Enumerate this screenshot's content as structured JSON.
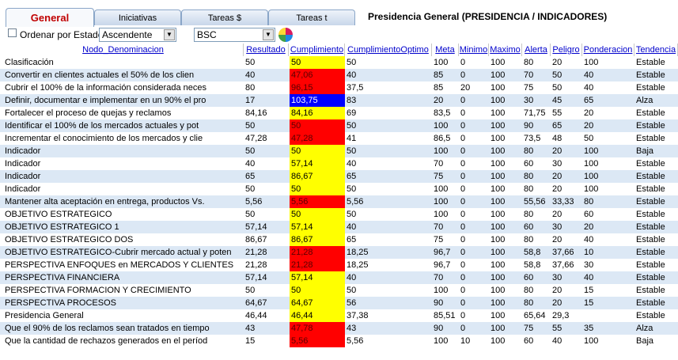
{
  "tabs": [
    {
      "label": "General"
    },
    {
      "label": "Iniciativas"
    },
    {
      "label": "Tareas $"
    },
    {
      "label": "Tareas t"
    }
  ],
  "page_title": "Presidencia General (PRESIDENCIA / INDICADORES)",
  "toolbar": {
    "order_label": "Ordenar por Estado",
    "sort_value": "Ascendente",
    "view_value": "BSC"
  },
  "colors": {
    "yellow": "#ffff00",
    "red": "#ff0000",
    "blue": "#0000ff",
    "row_alt": "#dce8f5"
  },
  "table": {
    "columns": [
      "Nodo_Denominacion",
      "Resultado",
      "Cumplimiento",
      "CumplimientoOptimo",
      "Meta",
      "Minimo",
      "Maximo",
      "Alerta",
      "Peligro",
      "Ponderacion",
      "Tendencia"
    ],
    "rows": [
      {
        "nodo": "Clasificación",
        "resultado": "50",
        "cumplimiento": "50",
        "status": "yellow",
        "optimo": "50",
        "meta": "100",
        "minimo": "0",
        "maximo": "100",
        "alerta": "80",
        "peligro": "20",
        "ponderacion": "100",
        "tendencia": "Estable"
      },
      {
        "nodo": "Convertir en clientes actuales el 50% de los clien",
        "resultado": "40",
        "cumplimiento": "47,06",
        "status": "red",
        "optimo": "40",
        "meta": "85",
        "minimo": "0",
        "maximo": "100",
        "alerta": "70",
        "peligro": "50",
        "ponderacion": "40",
        "tendencia": "Estable"
      },
      {
        "nodo": "Cubrir el 100% de la información considerada neces",
        "resultado": "80",
        "cumplimiento": "96,15",
        "status": "red",
        "optimo": "37,5",
        "meta": "85",
        "minimo": "20",
        "maximo": "100",
        "alerta": "75",
        "peligro": "50",
        "ponderacion": "40",
        "tendencia": "Estable"
      },
      {
        "nodo": "Definir, documentar e implementar en un 90% el pro",
        "resultado": "17",
        "cumplimiento": "103,75",
        "status": "blue",
        "optimo": "83",
        "meta": "20",
        "minimo": "0",
        "maximo": "100",
        "alerta": "30",
        "peligro": "45",
        "ponderacion": "65",
        "tendencia": "Alza"
      },
      {
        "nodo": "Fortalecer el proceso de quejas y reclamos",
        "resultado": "84,16",
        "cumplimiento": "84,16",
        "status": "yellow",
        "optimo": "69",
        "meta": "83,5",
        "minimo": "0",
        "maximo": "100",
        "alerta": "71,75",
        "peligro": "55",
        "ponderacion": "20",
        "tendencia": "Estable"
      },
      {
        "nodo": "Identificar el 100% de los mercados actuales y pot",
        "resultado": "50",
        "cumplimiento": "50",
        "status": "red",
        "optimo": "50",
        "meta": "100",
        "minimo": "0",
        "maximo": "100",
        "alerta": "90",
        "peligro": "65",
        "ponderacion": "20",
        "tendencia": "Estable"
      },
      {
        "nodo": "Incrementar el conocimiento de los mercados y clie",
        "resultado": "47,28",
        "cumplimiento": "47,28",
        "status": "red",
        "optimo": "41",
        "meta": "86,5",
        "minimo": "0",
        "maximo": "100",
        "alerta": "73,5",
        "peligro": "48",
        "ponderacion": "50",
        "tendencia": "Estable"
      },
      {
        "nodo": "Indicador",
        "resultado": "50",
        "cumplimiento": "50",
        "status": "yellow",
        "optimo": "50",
        "meta": "100",
        "minimo": "0",
        "maximo": "100",
        "alerta": "80",
        "peligro": "20",
        "ponderacion": "100",
        "tendencia": "Baja"
      },
      {
        "nodo": "Indicador",
        "resultado": "40",
        "cumplimiento": "57,14",
        "status": "yellow",
        "optimo": "40",
        "meta": "70",
        "minimo": "0",
        "maximo": "100",
        "alerta": "60",
        "peligro": "30",
        "ponderacion": "100",
        "tendencia": "Estable"
      },
      {
        "nodo": "Indicador",
        "resultado": "65",
        "cumplimiento": "86,67",
        "status": "yellow",
        "optimo": "65",
        "meta": "75",
        "minimo": "0",
        "maximo": "100",
        "alerta": "80",
        "peligro": "20",
        "ponderacion": "100",
        "tendencia": "Estable"
      },
      {
        "nodo": "Indicador",
        "resultado": "50",
        "cumplimiento": "50",
        "status": "yellow",
        "optimo": "50",
        "meta": "100",
        "minimo": "0",
        "maximo": "100",
        "alerta": "80",
        "peligro": "20",
        "ponderacion": "100",
        "tendencia": "Estable"
      },
      {
        "nodo": "Mantener alta aceptación en entrega, productos Vs.",
        "resultado": "5,56",
        "cumplimiento": "5,56",
        "status": "red",
        "optimo": "5,56",
        "meta": "100",
        "minimo": "0",
        "maximo": "100",
        "alerta": "55,56",
        "peligro": "33,33",
        "ponderacion": "80",
        "tendencia": "Estable"
      },
      {
        "nodo": "OBJETIVO ESTRATEGICO",
        "resultado": "50",
        "cumplimiento": "50",
        "status": "yellow",
        "optimo": "50",
        "meta": "100",
        "minimo": "0",
        "maximo": "100",
        "alerta": "80",
        "peligro": "20",
        "ponderacion": "60",
        "tendencia": "Estable"
      },
      {
        "nodo": "OBJETIVO ESTRATEGICO 1",
        "resultado": "57,14",
        "cumplimiento": "57,14",
        "status": "yellow",
        "optimo": "40",
        "meta": "70",
        "minimo": "0",
        "maximo": "100",
        "alerta": "60",
        "peligro": "30",
        "ponderacion": "20",
        "tendencia": "Estable"
      },
      {
        "nodo": "OBJETIVO ESTRATEGICO DOS",
        "resultado": "86,67",
        "cumplimiento": "86,67",
        "status": "yellow",
        "optimo": "65",
        "meta": "75",
        "minimo": "0",
        "maximo": "100",
        "alerta": "80",
        "peligro": "20",
        "ponderacion": "40",
        "tendencia": "Estable"
      },
      {
        "nodo": "OBJETIVO ESTRATEGICO-Cubrir mercado actual y poten",
        "resultado": "21,28",
        "cumplimiento": "21,28",
        "status": "red",
        "optimo": "18,25",
        "meta": "96,7",
        "minimo": "0",
        "maximo": "100",
        "alerta": "58,8",
        "peligro": "37,66",
        "ponderacion": "10",
        "tendencia": "Estable"
      },
      {
        "nodo": "PERSPECTIVA ENFOQUES en MERCADOS Y CLIENTES",
        "resultado": "21,28",
        "cumplimiento": "21,28",
        "status": "red",
        "optimo": "18,25",
        "meta": "96,7",
        "minimo": "0",
        "maximo": "100",
        "alerta": "58,8",
        "peligro": "37,66",
        "ponderacion": "30",
        "tendencia": "Estable"
      },
      {
        "nodo": "PERSPECTIVA FINANCIERA",
        "resultado": "57,14",
        "cumplimiento": "57,14",
        "status": "yellow",
        "optimo": "40",
        "meta": "70",
        "minimo": "0",
        "maximo": "100",
        "alerta": "60",
        "peligro": "30",
        "ponderacion": "40",
        "tendencia": "Estable"
      },
      {
        "nodo": "PERSPECTIVA FORMACION Y CRECIMIENTO",
        "resultado": "50",
        "cumplimiento": "50",
        "status": "yellow",
        "optimo": "50",
        "meta": "100",
        "minimo": "0",
        "maximo": "100",
        "alerta": "80",
        "peligro": "20",
        "ponderacion": "15",
        "tendencia": "Estable"
      },
      {
        "nodo": "PERSPECTIVA PROCESOS",
        "resultado": "64,67",
        "cumplimiento": "64,67",
        "status": "yellow",
        "optimo": "56",
        "meta": "90",
        "minimo": "0",
        "maximo": "100",
        "alerta": "80",
        "peligro": "20",
        "ponderacion": "15",
        "tendencia": "Estable"
      },
      {
        "nodo": "Presidencia General",
        "resultado": "46,44",
        "cumplimiento": "46,44",
        "status": "yellow",
        "optimo": "37,38",
        "meta": "85,51",
        "minimo": "0",
        "maximo": "100",
        "alerta": "65,64",
        "peligro": "29,3",
        "ponderacion": "",
        "tendencia": "Estable"
      },
      {
        "nodo": "Que el 90% de los reclamos sean tratados en tiempo",
        "resultado": "43",
        "cumplimiento": "47,78",
        "status": "red",
        "optimo": "43",
        "meta": "90",
        "minimo": "0",
        "maximo": "100",
        "alerta": "75",
        "peligro": "55",
        "ponderacion": "35",
        "tendencia": "Alza"
      },
      {
        "nodo": "Que la cantidad de rechazos generados en el períod",
        "resultado": "15",
        "cumplimiento": "5,56",
        "status": "red",
        "optimo": "5,56",
        "meta": "100",
        "minimo": "10",
        "maximo": "100",
        "alerta": "60",
        "peligro": "40",
        "ponderacion": "100",
        "tendencia": "Baja"
      }
    ]
  }
}
